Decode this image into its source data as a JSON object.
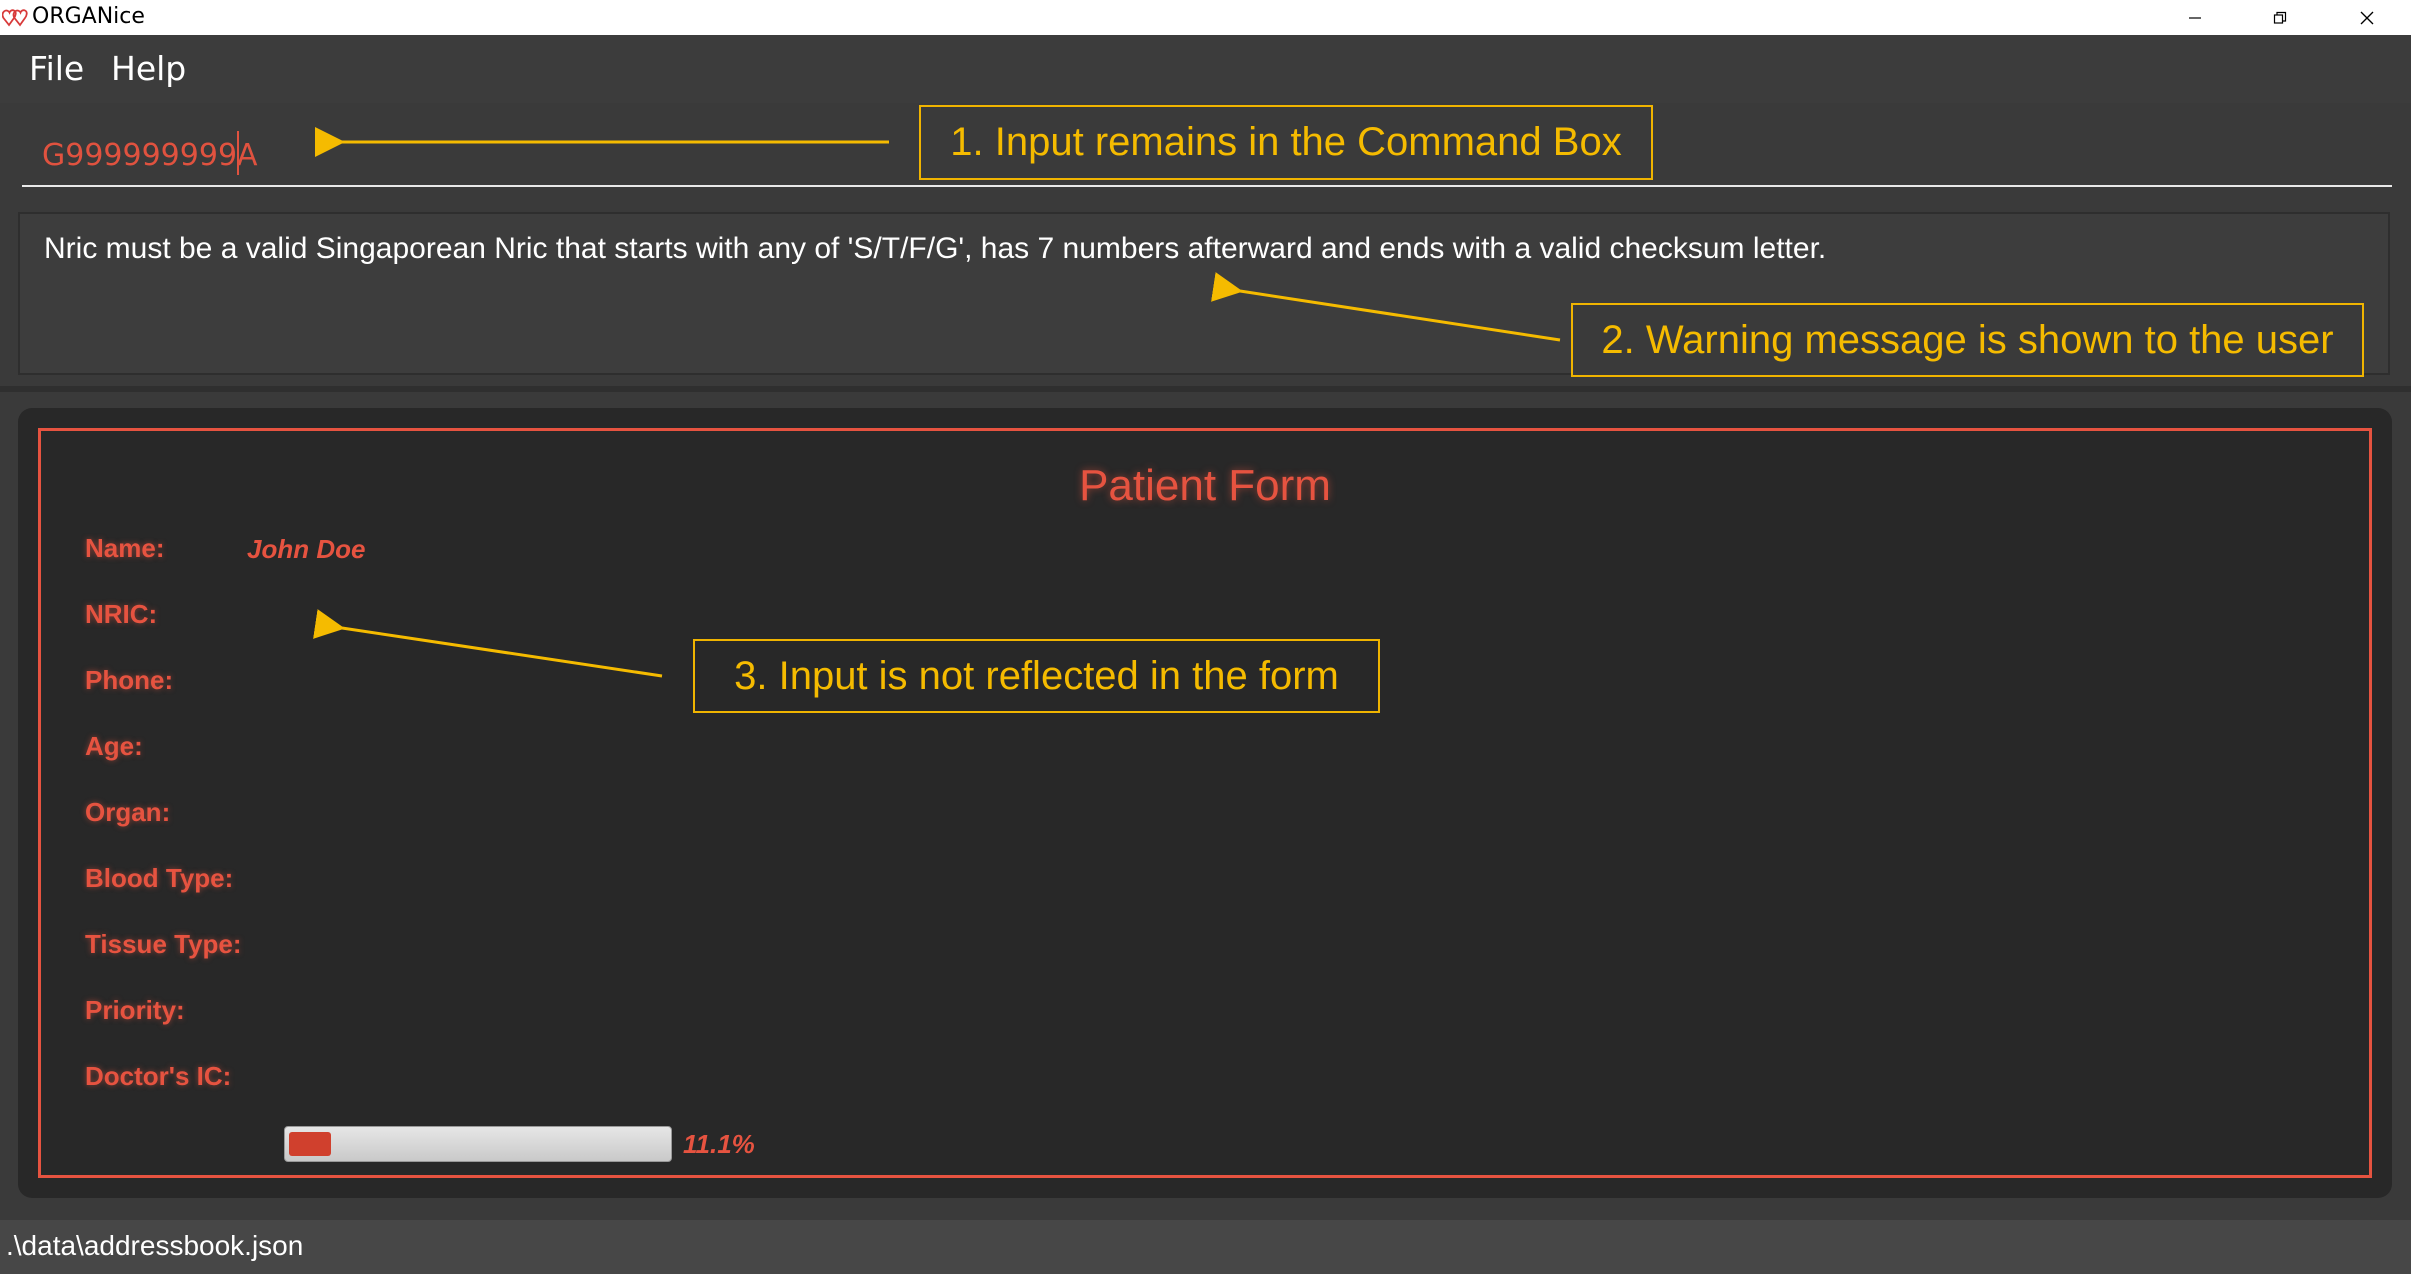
{
  "window": {
    "title": "ORGANice",
    "logo_icon": "double-heart-icon",
    "controls": [
      "minimize-icon",
      "restore-icon",
      "close-icon"
    ]
  },
  "menu": {
    "file": "File",
    "help": "Help"
  },
  "command_box": {
    "value": "G999999999A"
  },
  "result_display": {
    "message": "Nric must be a valid Singaporean Nric that starts with any of 'S/T/F/G', has 7 numbers afterward and ends with a valid checksum letter."
  },
  "form": {
    "title": "Patient Form",
    "fields": [
      {
        "label": "Name:",
        "value": "John Doe"
      },
      {
        "label": "NRIC:",
        "value": ""
      },
      {
        "label": "Phone:",
        "value": ""
      },
      {
        "label": "Age:",
        "value": ""
      },
      {
        "label": "Organ:",
        "value": ""
      },
      {
        "label": "Blood Type:",
        "value": ""
      },
      {
        "label": "Tissue Type:",
        "value": ""
      },
      {
        "label": "Priority:",
        "value": ""
      },
      {
        "label": "Doctor's IC:",
        "value": ""
      }
    ],
    "progress": {
      "fraction": 0.111,
      "text": "11.1%"
    }
  },
  "status_bar": {
    "path": ".\\data\\addressbook.json"
  },
  "annotations": {
    "one": "1. Input remains in the Command Box",
    "two": "2. Warning message is shown to the user",
    "three": "3. Input is not reflected in the form"
  },
  "colors": {
    "accent": "#e65340",
    "annotation": "#f5bb00",
    "background": "#3a3a3a",
    "form_background": "#282828"
  }
}
